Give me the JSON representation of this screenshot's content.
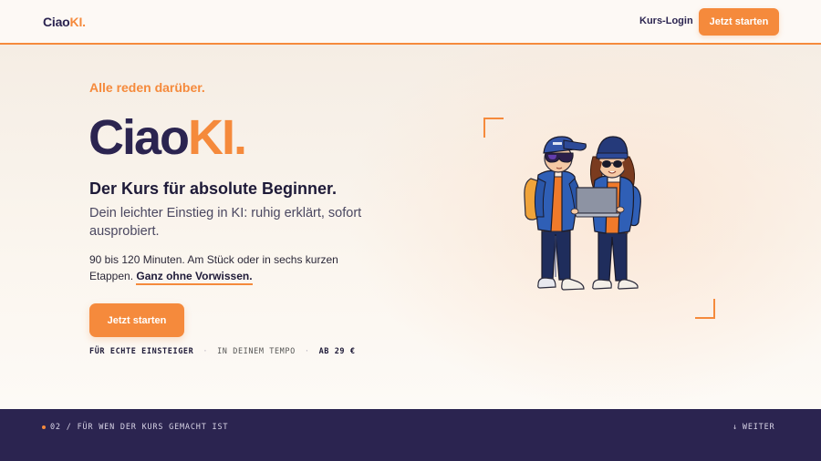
{
  "header": {
    "logo_main": "Ciao",
    "logo_accent": "KI.",
    "login_label": "Kurs-Login",
    "cta_label": "Jetzt starten"
  },
  "hero": {
    "eyebrow": "Alle reden darüber.",
    "title_main": "Ciao",
    "title_accent": "KI.",
    "subtitle": "Der Kurs für absolute Beginner.",
    "lead": "Dein leichter Einstieg in KI: ruhig erklärt, sofort ausprobiert.",
    "body": "90 bis 120 Minuten. Am Stück oder in sechs kurzen Etappen.",
    "body_emphasis": "Ganz ohne Vorwissen.",
    "cta_label": "Jetzt starten",
    "meta": [
      "FÜR ECHTE EINSTEIGER",
      "IN DEINEM TEMPO",
      "AB 29 €"
    ],
    "meta_separator": "·",
    "illustration_icon": "two-kids-with-laptop-illustration"
  },
  "footer": {
    "section_label": "02 / FÜR WEN DER KURS GEMACHT IST",
    "next_label": "WEITER",
    "next_icon": "arrow-down-icon"
  },
  "colors": {
    "accent": "#f58a3c",
    "navy": "#2b2450",
    "background": "#fbf6f0"
  }
}
